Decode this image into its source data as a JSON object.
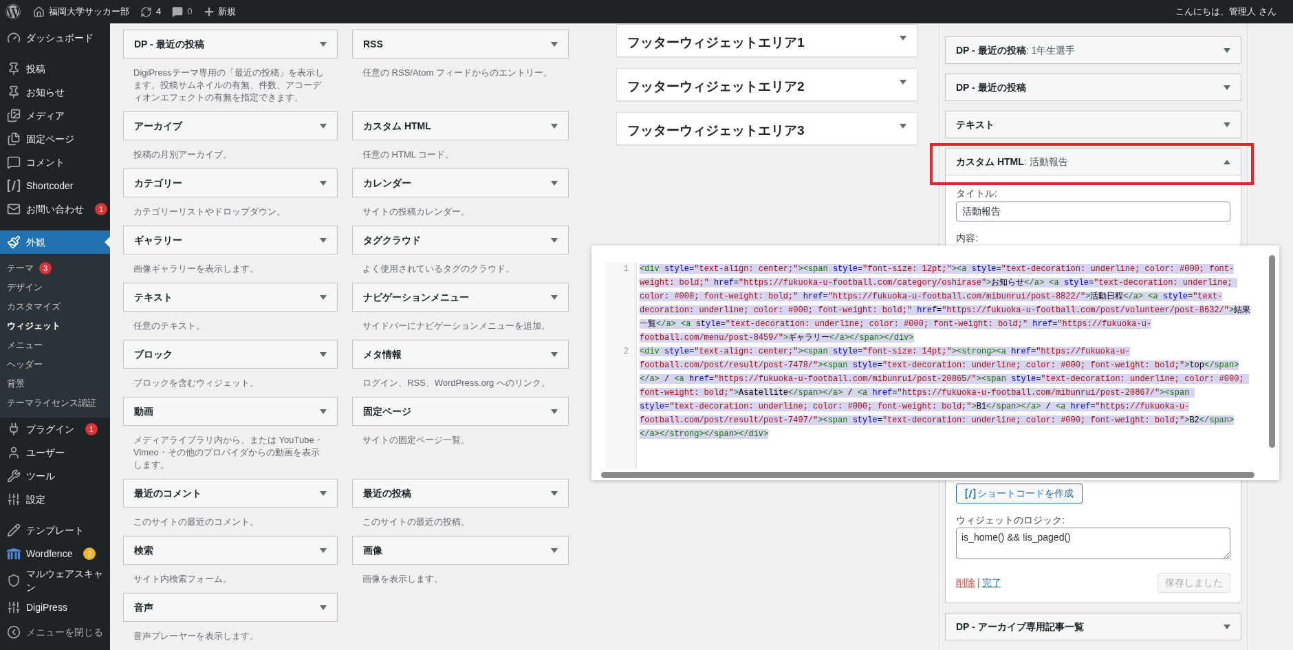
{
  "admin_bar": {
    "site_name": "福岡大学サッカー部",
    "updates": "4",
    "comments": "0",
    "new_label": "新規",
    "greeting": "こんにちは、管理人 さん"
  },
  "sidebar": {
    "sections": [
      {
        "items": [
          {
            "label": "ダッシュボード",
            "selected": false
          }
        ]
      },
      {
        "items": [
          {
            "label": "投稿",
            "selected": false
          },
          {
            "label": "お知らせ",
            "selected": false
          },
          {
            "label": "メディア",
            "selected": false
          },
          {
            "label": "固定ページ",
            "selected": false
          },
          {
            "label": "コメント",
            "selected": false
          },
          {
            "label": "Shortcoder",
            "selected": false
          },
          {
            "label": "お問い合わせ",
            "selected": false,
            "badge": "1",
            "color": "#d63638"
          }
        ]
      },
      {
        "items": [
          {
            "label": "外観",
            "selected": true,
            "children": [
              {
                "label": "テーマ",
                "selected": false,
                "badge": "3",
                "color": "#d63638"
              },
              {
                "label": "デザイン",
                "selected": false
              },
              {
                "label": "カスタマイズ",
                "selected": false
              },
              {
                "label": "ウィジェット",
                "selected": true
              },
              {
                "label": "メニュー",
                "selected": false
              },
              {
                "label": "ヘッダー",
                "selected": false
              },
              {
                "label": "背景",
                "selected": false
              },
              {
                "label": "テーマライセンス認証",
                "selected": false
              }
            ]
          },
          {
            "label": "プラグイン",
            "selected": false,
            "badge": "1",
            "color": "#d63638"
          },
          {
            "label": "ユーザー",
            "selected": false
          },
          {
            "label": "ツール",
            "selected": false
          },
          {
            "label": "設定",
            "selected": false
          }
        ]
      },
      {
        "items": [
          {
            "label": "テンプレート",
            "selected": false
          },
          {
            "label": "Wordfence",
            "selected": false,
            "badge": "2",
            "color": "#f0b323"
          },
          {
            "label": "マルウェアスキャン",
            "selected": false
          },
          {
            "label": "DigiPress",
            "selected": false
          }
        ]
      }
    ],
    "collapse_label": "メニューを閉じる"
  },
  "available_widgets": [
    {
      "title": "DP - 最近の投稿",
      "description": "DigiPressテーマ専用の「最近の投稿」を表示します。投稿サムネイルの有無、件数、アコーディオンエフェクトの有無を指定できます。"
    },
    {
      "title": "RSS",
      "description": "任意の RSS/Atom フィードからのエントリー。"
    },
    {
      "title": "アーカイブ",
      "description": "投稿の月別アーカイブ。"
    },
    {
      "title": "カスタム HTML",
      "description": "任意の HTML コード。"
    },
    {
      "title": "カテゴリー",
      "description": "カテゴリーリストやドロップダウン。"
    },
    {
      "title": "カレンダー",
      "description": "サイトの投稿カレンダー。"
    },
    {
      "title": "ギャラリー",
      "description": "画像ギャラリーを表示します。"
    },
    {
      "title": "タグクラウド",
      "description": "よく使用されているタグのクラウド。"
    },
    {
      "title": "テキスト",
      "description": "任意のテキスト。"
    },
    {
      "title": "ナビゲーションメニュー",
      "description": "サイドバーにナビゲーションメニューを追加。"
    },
    {
      "title": "ブロック",
      "description": "ブロックを含むウィジェット。"
    },
    {
      "title": "メタ情報",
      "description": "ログイン、RSS、WordPress.org へのリンク。"
    },
    {
      "title": "動画",
      "description": "メディアライブラリ内から、または YouTube・Vimeo・その他のプロバイダからの動画を表示します。"
    },
    {
      "title": "固定ページ",
      "description": "サイトの固定ページ一覧。"
    },
    {
      "title": "最近のコメント",
      "description": "このサイトの最近のコメント。"
    },
    {
      "title": "最近の投稿",
      "description": "このサイトの最近の投稿。"
    },
    {
      "title": "検索",
      "description": "サイト内検索フォーム。"
    },
    {
      "title": "画像",
      "description": "画像を表示します。"
    },
    {
      "title": "音声",
      "description": "音声プレーヤーを表示します。"
    }
  ],
  "widget_areas": [
    {
      "title": "フッターウィジェットエリア1"
    },
    {
      "title": "フッターウィジェットエリア2"
    },
    {
      "title": "フッターウィジェットエリア3"
    }
  ],
  "active_widgets": [
    {
      "title": "DP - 最近の投稿",
      "subtitle": ": 1年生選手",
      "expanded": false,
      "highlighted": false
    },
    {
      "title": "DP - 最近の投稿",
      "expanded": false,
      "highlighted": false
    },
    {
      "title": "テキスト",
      "expanded": false,
      "highlighted": false
    },
    {
      "title": "カスタム HTML",
      "subtitle": ": 活動報告",
      "expanded": true,
      "highlighted": true,
      "form": {
        "title_label": "タイトル:",
        "title_value": "活動報告",
        "content_label": "内容:",
        "shortcode_button": "ショートコードを作成",
        "logic_label": "ウィジェットのロジック:",
        "logic_value": "is_home() && !is_paged()",
        "delete_link": "削除",
        "separator": "|",
        "done_link": "完了",
        "save_button": "保存しました",
        "save_disabled": true
      }
    },
    {
      "title": "DP - アーカイブ専用記事一覧",
      "expanded": false,
      "highlighted": false
    }
  ],
  "code_editor": {
    "lines": [
      {
        "number": "1",
        "code": "<div style=\"text-align: center;\"><span style=\"font-size: 12pt;\"><a style=\"text-decoration: underline; color: #000; font-weight: bold;\" href=\"https://fukuoka-u-football.com/category/oshirase\">お知らせ</a> <a style=\"text-decoration: underline; color: #000; font-weight: bold;\" href=\"https://fukuoka-u-football.com/mibunrui/post-8822/\">活動日程</a> <a style=\"text-decoration: underline; color: #000; font-weight: bold;\" href=\"https://fukuoka-u-football.com/post/volunteer/post-8632/\">結果一覧</a> <a style=\"text-decoration: underline; color: #000; font-weight: bold;\" href=\"https://fukuoka-u-football.com/menu/post-8459/\">ギャラリー</a></span></div>",
        "selected": true
      },
      {
        "number": "2",
        "code": "<div style=\"text-align: center;\"><span style=\"font-size: 14pt;\"><strong><a href=\"https://fukuoka-u-football.com/post/result/post-7478/\"><span style=\"text-decoration: underline; color: #000; font-weight: bold;\">top</span></a> / <a href=\"https://fukuoka-u-football.com/mibunrui/post-20865/\"><span style=\"text-decoration: underline; color: #000; font-weight: bold;\">Asatellite</span></a> / <a href=\"https://fukuoka-u-football.com/mibunrui/post-20867/\"><span style=\"text-decoration: underline; color: #000; font-weight: bold;\">B1</span></a> / <a href=\"https://fukuoka-u-football.com/post/result/post-7497/\"><span style=\"text-decoration: underline; color: #000; font-weight: bold;\">B2</span></a></strong></span></div>",
        "selected": true
      }
    ]
  }
}
